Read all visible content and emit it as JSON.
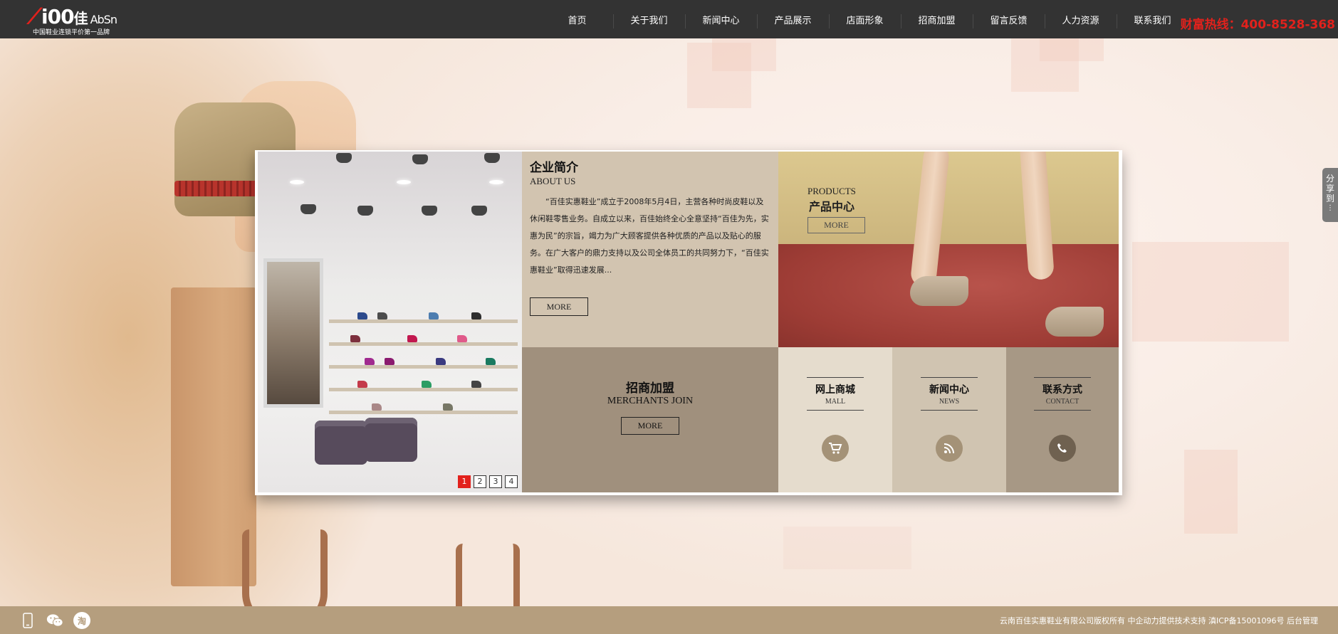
{
  "header": {
    "logo_text_a": "i00",
    "logo_text_b": "佳",
    "logo_text_c": "AbSn",
    "logo_slogan": "中国鞋业连锁平价第一品牌",
    "nav": [
      {
        "label": "首页"
      },
      {
        "label": "关于我们"
      },
      {
        "label": "新闻中心"
      },
      {
        "label": "产品展示"
      },
      {
        "label": "店面形象"
      },
      {
        "label": "招商加盟"
      },
      {
        "label": "留言反馈"
      },
      {
        "label": "人力资源"
      },
      {
        "label": "联系我们"
      }
    ],
    "hotline": "财富热线：400-8528-368"
  },
  "share": {
    "label": "分享到"
  },
  "slider": {
    "pages": [
      "1",
      "2",
      "3",
      "4"
    ],
    "active_page": 1
  },
  "about": {
    "title": "企业简介",
    "title_en": "ABOUT US",
    "body": "“百佳实惠鞋业”成立于2008年5月4日，主营各种时尚皮鞋以及休闲鞋零售业务。自成立以来，百佳始终全心全意坚持“百佳为先，实惠为民”的宗旨，竭力为广大顾客提供各种优质的产品以及贴心的服务。在广大客户的鼎力支持以及公司全体员工的共同努力下，“百佳实惠鞋业”取得迅速发展...",
    "more": "MORE"
  },
  "products": {
    "title_en": "PRODUCTS",
    "title": "产品中心",
    "more": "MORE"
  },
  "merchants": {
    "title": "招商加盟",
    "title_en": "MERCHANTS JOIN",
    "more": "MORE"
  },
  "tiles": {
    "mall": {
      "title": "网上商城",
      "title_en": "MALL",
      "icon": "cart-icon"
    },
    "news": {
      "title": "新闻中心",
      "title_en": "NEWS",
      "icon": "rss-icon"
    },
    "contact": {
      "title": "联系方式",
      "title_en": "CONTACT",
      "icon": "phone-icon"
    }
  },
  "footer": {
    "icons": [
      "mobile-icon",
      "wechat-icon",
      "taobao-icon"
    ],
    "taobao_glyph": "淘",
    "copyright": "云南百佳实惠鞋业有限公司版权所有 中企动力提供技术支持 滇ICP备15001096号 后台管理"
  },
  "colors": {
    "header_bg": "#333333",
    "accent_red": "#e2211c",
    "footer_bg": "#b59e7e"
  }
}
